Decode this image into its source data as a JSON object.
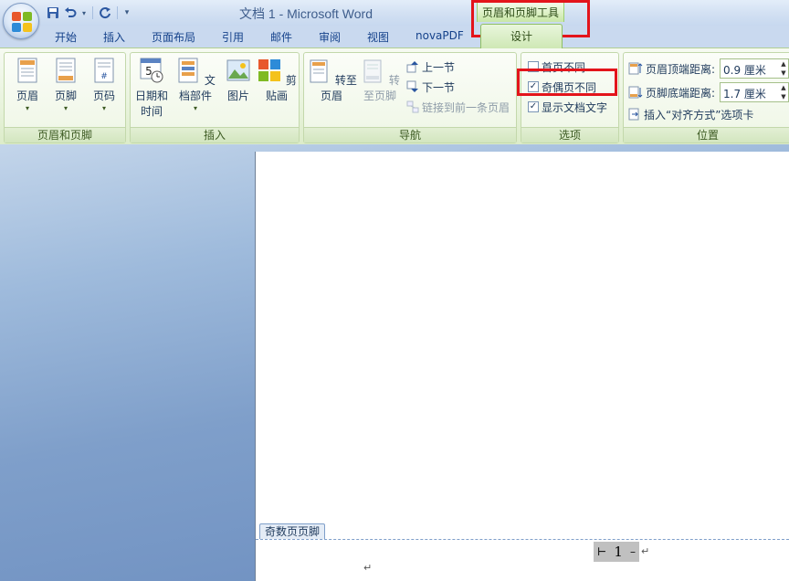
{
  "window": {
    "title": "文档 1 - Microsoft Word"
  },
  "context_tab": {
    "group_label": "页眉和页脚工具",
    "tab_label": "设计"
  },
  "tabs": [
    {
      "label": "开始"
    },
    {
      "label": "插入"
    },
    {
      "label": "页面布局"
    },
    {
      "label": "引用"
    },
    {
      "label": "邮件"
    },
    {
      "label": "审阅"
    },
    {
      "label": "视图"
    },
    {
      "label": "novaPDF"
    }
  ],
  "ribbon": {
    "header_footer_group": {
      "label": "页眉和页脚",
      "header_label": "页眉",
      "footer_label": "页脚",
      "page_number_label": "页码"
    },
    "insert_group": {
      "label": "插入",
      "datetime_label_1": "日期和",
      "datetime_label_2": "时间",
      "quickparts_label": "文档部件",
      "picture_label": "图片",
      "clipart_label": "剪贴画"
    },
    "navigation_group": {
      "label": "导航",
      "goto_header_label": "转至页眉",
      "goto_footer_label": "转至页脚",
      "previous_section_label": "上一节",
      "next_section_label": "下一节",
      "link_previous_label": "链接到前一条页眉"
    },
    "options_group": {
      "label": "选项",
      "different_first_page": {
        "label": "首页不同",
        "checked": false
      },
      "different_odd_even": {
        "label": "奇偶页不同",
        "checked": true
      },
      "show_document_text": {
        "label": "显示文档文字",
        "checked": true
      }
    },
    "position_group": {
      "label": "位置",
      "header_from_top_label": "页眉顶端距离:",
      "header_from_top_value": "0.9 厘米",
      "footer_from_bottom_label": "页脚底端距离:",
      "footer_from_bottom_value": "1.7 厘米",
      "insert_alignment_tab_label": "插入“对齐方式”选项卡"
    }
  },
  "document": {
    "footer_tag": "奇数页页脚",
    "page_number": "1",
    "para_mark": "↵"
  },
  "colors": {
    "highlight": "#e3141b",
    "context_green": "#9ccf71"
  }
}
